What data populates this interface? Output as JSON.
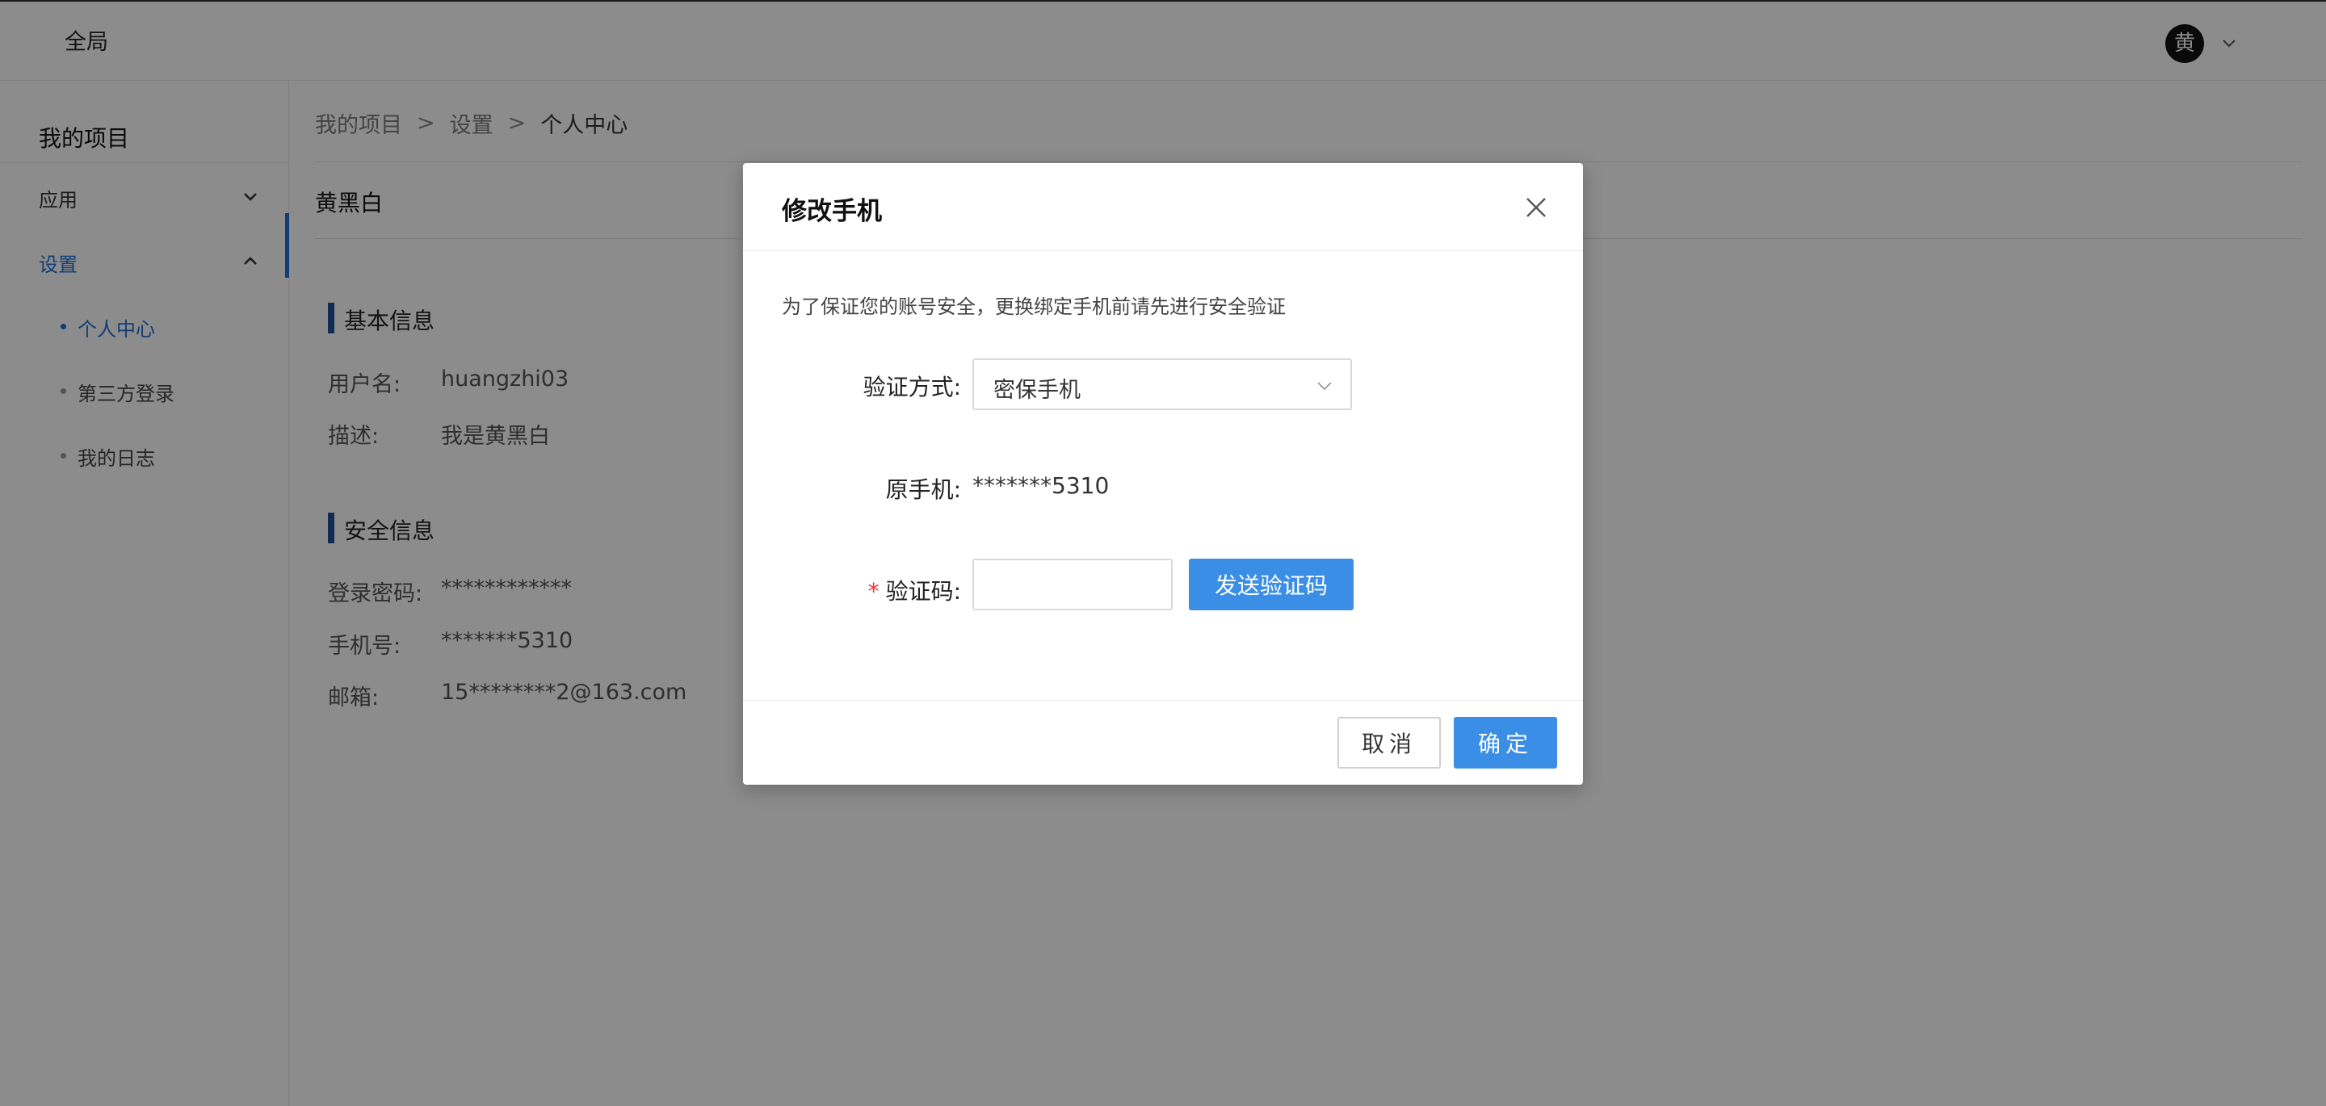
{
  "topbar": {
    "scope_label": "全局",
    "avatar_text": "黄"
  },
  "sidebar": {
    "title": "我的项目",
    "groups": [
      {
        "label": "应用",
        "expanded": false
      },
      {
        "label": "设置",
        "expanded": true
      }
    ],
    "sub_items": [
      {
        "label": "个人中心",
        "active": true
      },
      {
        "label": "第三方登录",
        "active": false
      },
      {
        "label": "我的日志",
        "active": false
      }
    ]
  },
  "breadcrumb": {
    "items": [
      "我的项目",
      "设置",
      "个人中心"
    ],
    "separator": ">"
  },
  "page": {
    "title": "黄黑白",
    "basic_section": {
      "title": "基本信息",
      "fields": [
        {
          "label": "用户名:",
          "value": "huangzhi03"
        },
        {
          "label": "描述:",
          "value": "我是黄黑白"
        }
      ]
    },
    "security_section": {
      "title": "安全信息",
      "fields": [
        {
          "label": "登录密码:",
          "value": "************"
        },
        {
          "label": "手机号:",
          "value": "*******5310"
        },
        {
          "label": "邮箱:",
          "value": "15********2@163.com"
        }
      ]
    }
  },
  "modal": {
    "title": "修改手机",
    "tip": "为了保证您的账号安全，更换绑定手机前请先进行安全验证",
    "verify_method_label": "验证方式:",
    "verify_method_value": "密保手机",
    "original_phone_label": "原手机:",
    "original_phone_value": "*******5310",
    "code_label": "验证码:",
    "code_required_mark": "*",
    "code_value": "",
    "send_code_label": "发送验证码",
    "cancel_label": "取消",
    "ok_label": "确定"
  },
  "colors": {
    "accent": "#3a8ee6",
    "sidebar_active": "#1f6fd6",
    "section_bar": "#1f4f9a",
    "required": "#e53935",
    "overlay": "rgba(0,0,0,0.45)"
  },
  "icons": {
    "close": "close-icon",
    "chevron_down": "chevron-down-icon",
    "chevron_up": "chevron-up-icon"
  }
}
